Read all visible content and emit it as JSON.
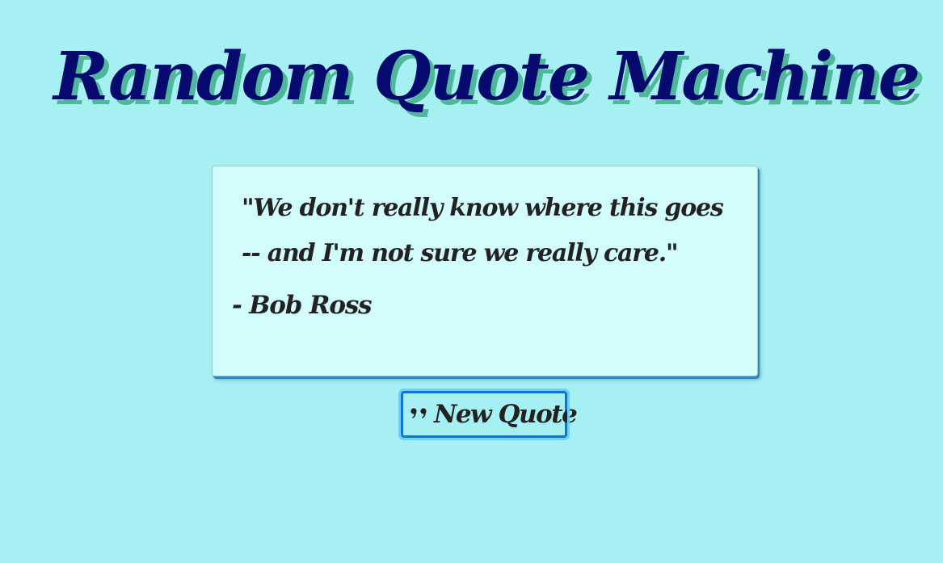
{
  "header": {
    "title": "Random Quote Machine"
  },
  "quote": {
    "text": "\"We don't really know where this goes -- and I'm not sure we really care.\"",
    "author": "- Bob Ross"
  },
  "button": {
    "label": "New Quote",
    "icon": "quote-left-icon"
  },
  "colors": {
    "background": "#a6eff2",
    "title": "#06096e",
    "title_shadow": "#4fb89a",
    "card": "#d2fcfc",
    "button_border": "#0a74d8"
  }
}
